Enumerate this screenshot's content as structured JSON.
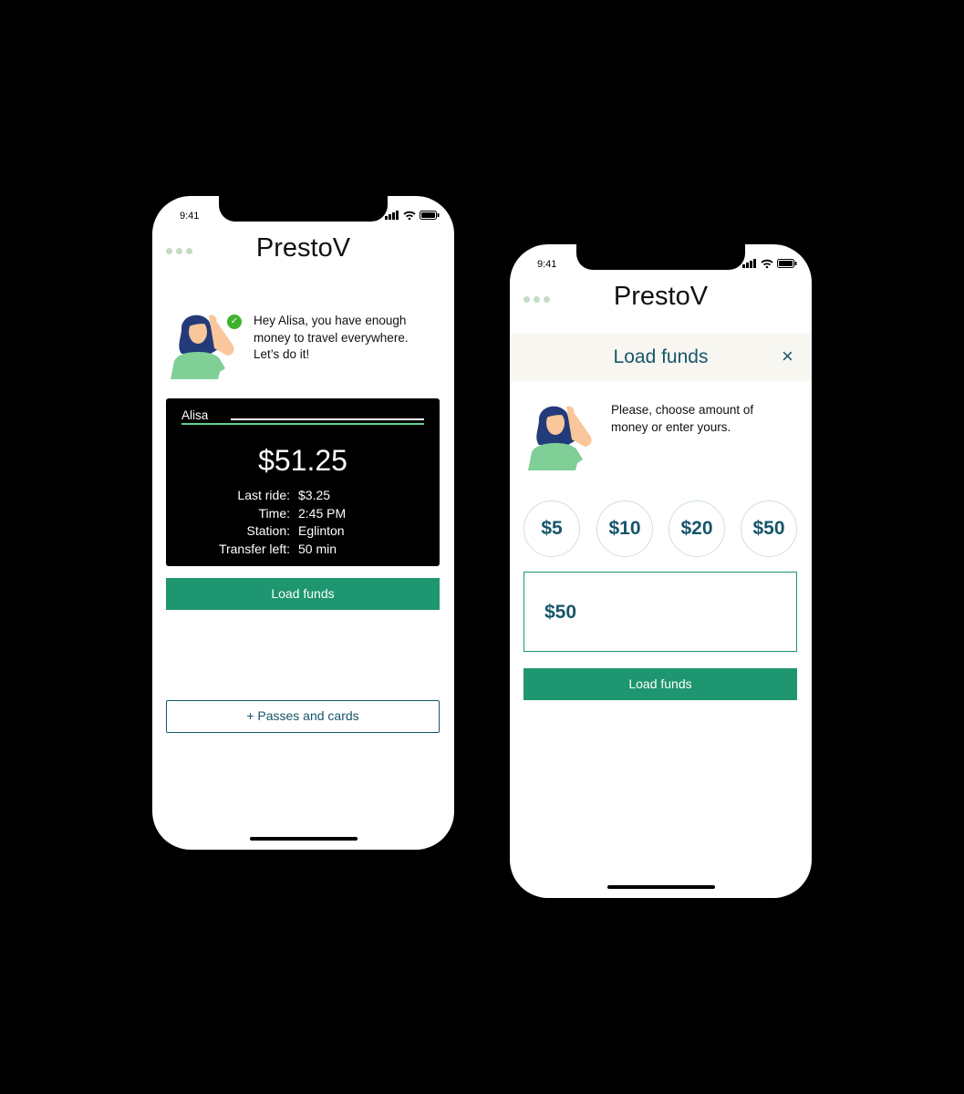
{
  "app_title": "PrestoV",
  "status_time": "9:41",
  "colors": {
    "accent": "#1e9670",
    "navy": "#17566b",
    "check": "#3fb12c",
    "band": "#f8f6f1"
  },
  "screen1": {
    "message": "Hey Alisa, you have enough money to travel everywhere. Let’s do it!",
    "card": {
      "name": "Alisa",
      "balance": "$51.25",
      "rows": [
        {
          "k": "Last ride:",
          "v": "$3.25"
        },
        {
          "k": "Time:",
          "v": "2:45 PM"
        },
        {
          "k": "Station:",
          "v": "Eglinton"
        },
        {
          "k": "Transfer left:",
          "v": "50 min"
        }
      ]
    },
    "load_button": "Load funds",
    "passes_button": "+ Passes and cards"
  },
  "screen2": {
    "header": "Load funds",
    "close": "×",
    "message": "Please, choose amount of money or enter yours.",
    "amounts": [
      "$5",
      "$10",
      "$20",
      "$50"
    ],
    "input_value": "$50",
    "load_button": "Load funds"
  }
}
